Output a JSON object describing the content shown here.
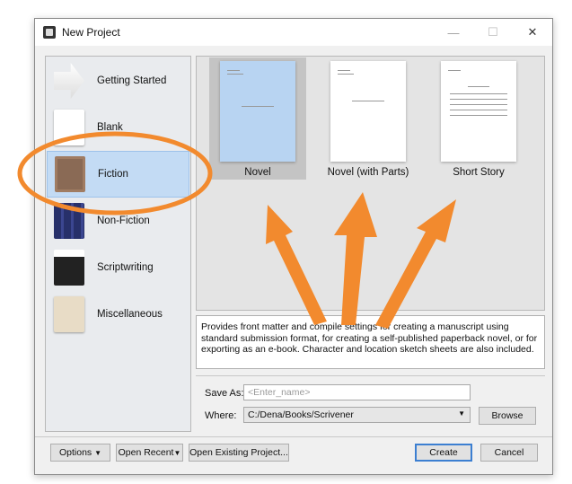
{
  "window": {
    "title": "New Project",
    "minimize": "—",
    "maximize": "☐",
    "close": "✕"
  },
  "categories": [
    {
      "label": "Getting Started"
    },
    {
      "label": "Blank"
    },
    {
      "label": "Fiction"
    },
    {
      "label": "Non-Fiction"
    },
    {
      "label": "Scriptwriting"
    },
    {
      "label": "Miscellaneous"
    }
  ],
  "templates": [
    {
      "label": "Novel"
    },
    {
      "label": "Novel (with Parts)"
    },
    {
      "label": "Short Story"
    }
  ],
  "description": "Provides front matter and compile settings for creating a manuscript using standard submission format, for creating a self-published paperback novel, or for exporting as an e-book. Character and location sketch sheets are also included.",
  "form": {
    "save_as_label": "Save As:",
    "save_as_placeholder": "<Enter_name>",
    "where_label": "Where:",
    "where_value": "C:/Dena/Books/Scrivener",
    "browse": "Browse"
  },
  "footer": {
    "options": "Options",
    "open_recent": "Open Recent",
    "open_existing": "Open Existing Project...",
    "create": "Create",
    "cancel": "Cancel"
  },
  "annotation_color": "#f28a2e"
}
